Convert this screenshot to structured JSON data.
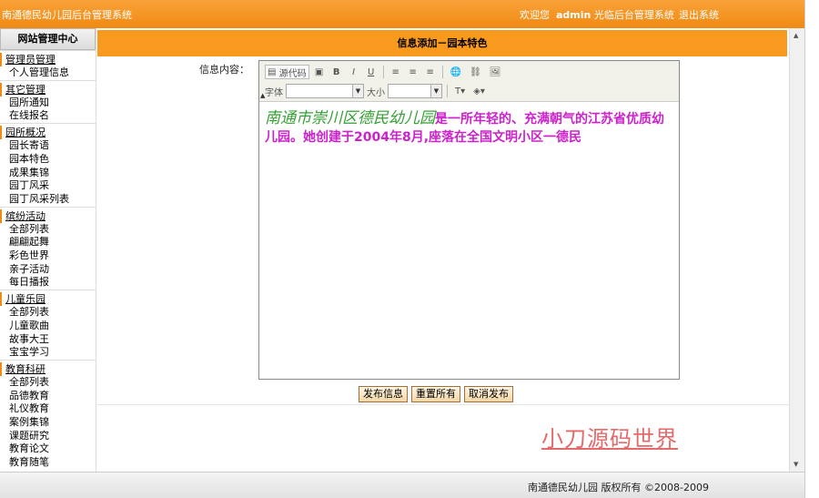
{
  "header": {
    "site_title": "南通德民幼儿园后台管理系统",
    "welcome_prefix": "欢迎您",
    "username": "admin",
    "welcome_suffix": "光临后台管理系统",
    "logout": "退出系统"
  },
  "sidebar": {
    "title": "网站管理中心",
    "sections": [
      {
        "title": "管理员管理",
        "items": [
          "个人管理信息"
        ]
      },
      {
        "title": "其它管理",
        "items": [
          "园所通知",
          "在线报名"
        ]
      },
      {
        "title": "园所概况",
        "items": [
          "园长寄语",
          "园本特色",
          "成果集锦",
          "园丁风采",
          "园丁风采列表"
        ]
      },
      {
        "title": "缤纷活动",
        "items": [
          "全部列表",
          "翩翩起舞",
          "彩色世界",
          "亲子活动",
          "每日播报"
        ]
      },
      {
        "title": "儿童乐园",
        "items": [
          "全部列表",
          "儿童歌曲",
          "故事大王",
          "宝宝学习"
        ]
      },
      {
        "title": "教育科研",
        "items": [
          "全部列表",
          "品德教育",
          "礼仪教育",
          "案例集锦",
          "课题研究",
          "教育论文",
          "教育随笔"
        ]
      }
    ]
  },
  "main": {
    "heading": "信息添加－园本特色",
    "field_label": "信息内容：",
    "editor": {
      "source_label": "源代码",
      "font_label": "字体",
      "size_label": "大小",
      "content_lead": "南通市崇川区德民幼儿园",
      "content_body": "是一所年轻的、充满朝气的江苏省优质幼儿园。她创建于2004年8月,座落在全国文明小区一德民"
    },
    "buttons": {
      "publish": "发布信息",
      "reset": "重置所有",
      "cancel": "取消发布"
    },
    "watermark": "小刀源码世界"
  },
  "footer": {
    "copyright": "南通德民幼儿园 版权所有 ©2008-2009"
  },
  "colors": {
    "accent": "#f08a12",
    "lead_text": "#35a035",
    "body_text": "#cc22cc",
    "watermark": "#e46a6a"
  }
}
